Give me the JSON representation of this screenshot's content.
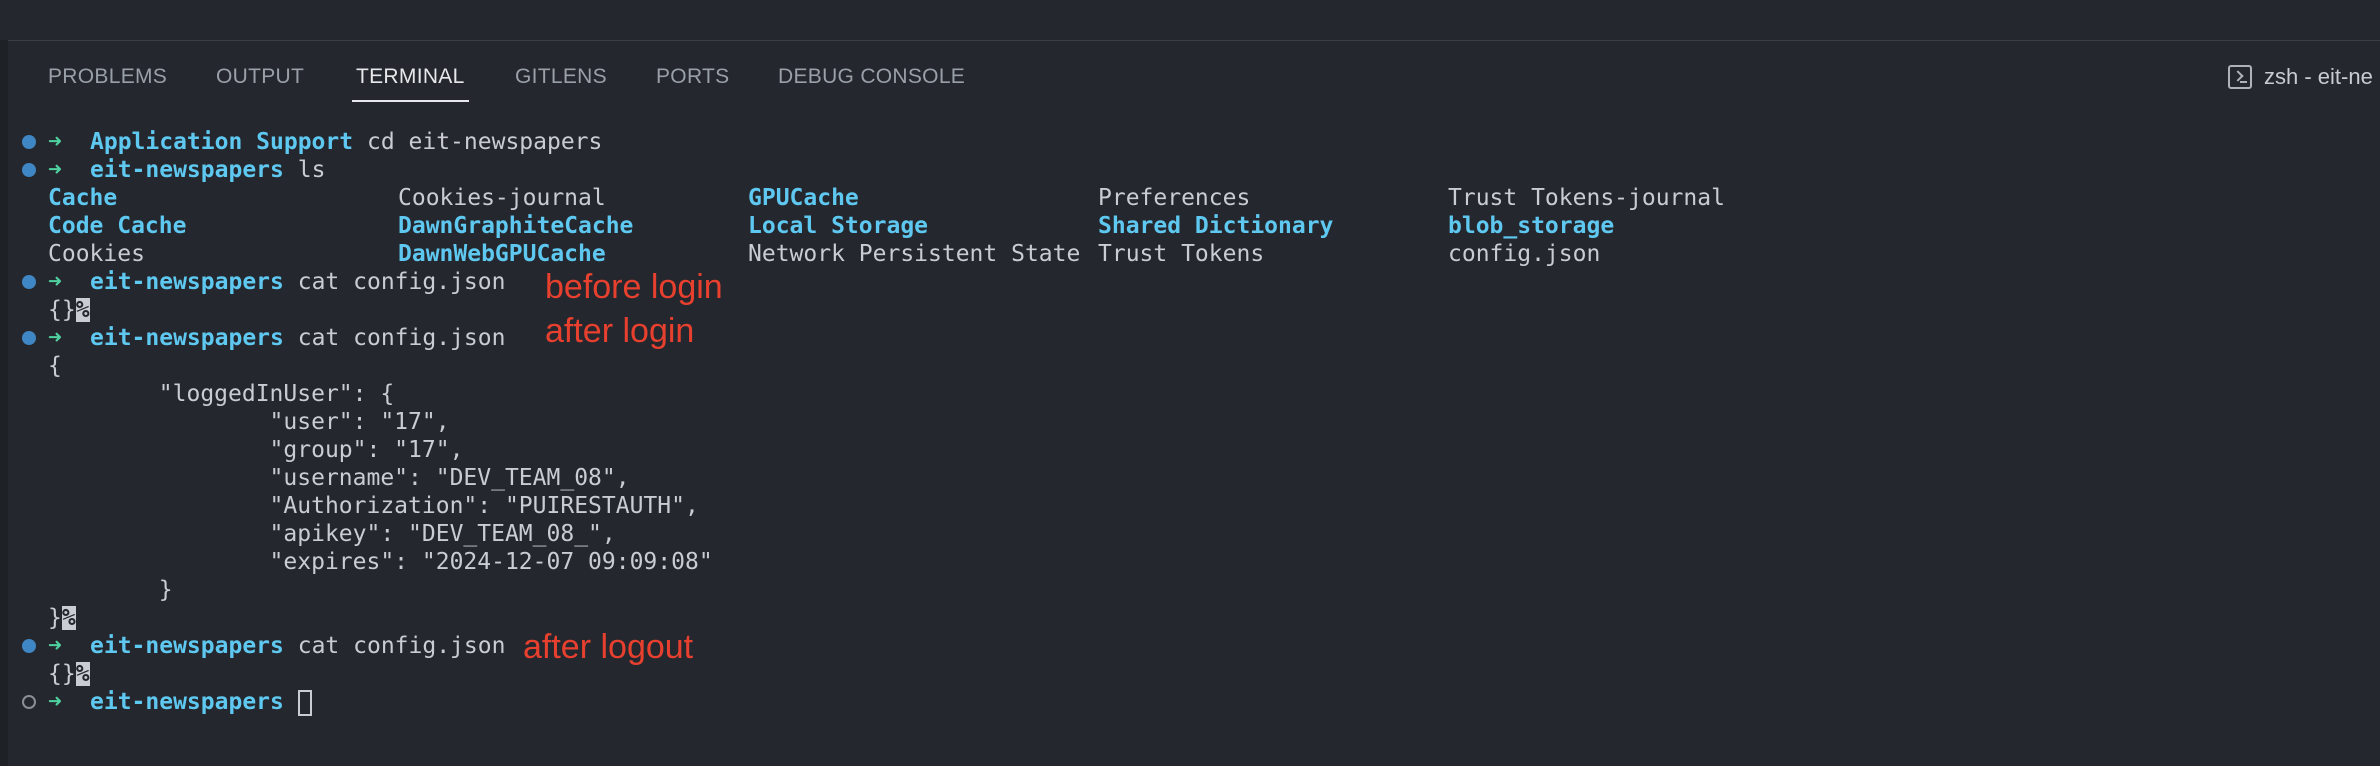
{
  "panel_tabs": {
    "problems": "PROBLEMS",
    "output": "OUTPUT",
    "terminal": "TERMINAL",
    "gitlens": "GITLENS",
    "ports": "PORTS",
    "debug_console": "DEBUG CONSOLE",
    "active": "TERMINAL"
  },
  "shell": {
    "label": "zsh - eit-ne",
    "icon": "terminal-icon"
  },
  "terminal": {
    "prompt_arrow": "➜",
    "cmd1": {
      "dir": "Application Support",
      "command": "cd eit-newspapers"
    },
    "cmd2": {
      "dir": "eit-newspapers",
      "command": "ls"
    },
    "ls_output": {
      "col1": [
        "Cache",
        "Code Cache",
        "Cookies"
      ],
      "col2": [
        "Cookies-journal",
        "DawnGraphiteCache",
        "DawnWebGPUCache"
      ],
      "col3": [
        "GPUCache",
        "Local Storage",
        "Network Persistent State"
      ],
      "col4": [
        "Preferences",
        "Shared Dictionary",
        "Trust Tokens"
      ],
      "col5": [
        "Trust Tokens-journal",
        "blob_storage",
        "config.json"
      ]
    },
    "cmd3": {
      "dir": "eit-newspapers",
      "command": "cat config.json",
      "output": "{}",
      "eol": "%"
    },
    "cmd4": {
      "dir": "eit-newspapers",
      "command": "cat config.json",
      "output_lines": [
        "{",
        "        \"loggedInUser\": {",
        "                \"user\": \"17\",",
        "                \"group\": \"17\",",
        "                \"username\": \"DEV_TEAM_08\",",
        "                \"Authorization\": \"PUIRESTAUTH\",",
        "                \"apikey\": \"DEV_TEAM_08_\",",
        "                \"expires\": \"2024-12-07 09:09:08\"",
        "        }",
        "}"
      ],
      "eol": "%"
    },
    "cmd5": {
      "dir": "eit-newspapers",
      "command": "cat config.json",
      "output": "{}",
      "eol": "%"
    },
    "cmd6": {
      "dir": "eit-newspapers"
    }
  },
  "annotations": {
    "before_login": "before login",
    "after_login": "after login",
    "after_logout": "after logout"
  },
  "colors": {
    "background": "#24272d",
    "directory_cyan": "#5ec8f0",
    "arrow_green": "#4fd1a0",
    "status_dot_blue": "#3f86c4",
    "annotation_red": "#e8402f"
  }
}
